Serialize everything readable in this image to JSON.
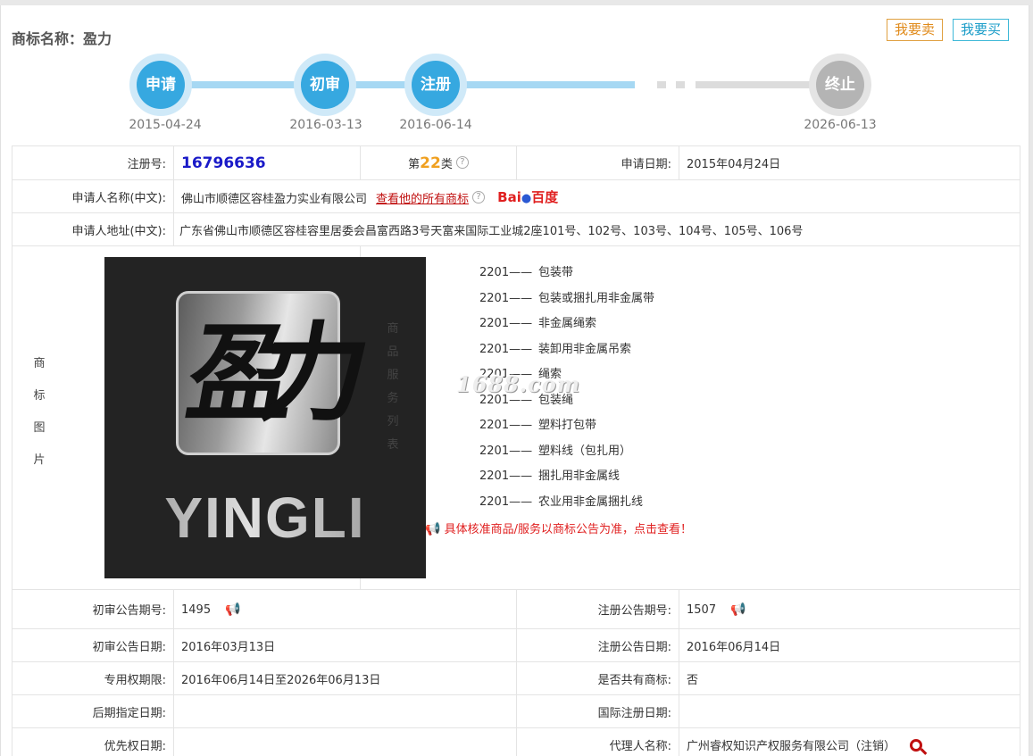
{
  "header": {
    "title": "商标名称：盈力",
    "sell_button": "我要卖",
    "buy_button": "我要买"
  },
  "timeline": {
    "steps": [
      {
        "label": "申请",
        "date": "2015-04-24"
      },
      {
        "label": "初审",
        "date": "2016-03-13"
      },
      {
        "label": "注册",
        "date": "2016-06-14"
      },
      {
        "label": "终止",
        "date": "2026-06-13"
      }
    ],
    "colors": {
      "active": "#36a8e0",
      "track": "#a6d8f3",
      "inactive": "#b4b4b4"
    }
  },
  "info": {
    "reg_no_label": "注册号:",
    "reg_no": "16796636",
    "class_prefix": "第",
    "class_num": "22",
    "class_suffix": "类",
    "apply_date_label": "申请日期:",
    "apply_date": "2015年04月24日",
    "applicant_label": "申请人名称(中文):",
    "applicant": "佛山市顺德区容桂盈力实业有限公司",
    "view_all_link": "查看他的所有商标",
    "baidu_text": "Bai",
    "baidu_text2": "百度",
    "address_label": "申请人地址(中文):",
    "address": "广东省佛山市顺德区容桂容里居委会昌富西路3号天富来国际工业城2座101号、102号、103号、104号、105号、106号",
    "image_label_chars": [
      "商",
      "标",
      "图",
      "片"
    ],
    "goods_label_chars": [
      "商",
      "品",
      "服",
      "务",
      "列",
      "表"
    ],
    "logo_text": "YINGLI",
    "logo_char": "盈力",
    "goods": [
      {
        "code": "2201——",
        "name": "包装带"
      },
      {
        "code": "2201——",
        "name": "包装或捆扎用非金属带"
      },
      {
        "code": "2201——",
        "name": "非金属绳索"
      },
      {
        "code": "2201——",
        "name": "装卸用非金属吊索"
      },
      {
        "code": "2201——",
        "name": "绳索"
      },
      {
        "code": "2201——",
        "name": "包装绳"
      },
      {
        "code": "2201——",
        "name": "塑料打包带"
      },
      {
        "code": "2201——",
        "name": "塑料线（包扎用）"
      },
      {
        "code": "2201——",
        "name": "捆扎用非金属线"
      },
      {
        "code": "2201——",
        "name": "农业用非金属捆扎线"
      }
    ],
    "goods_notice": "具体核准商品/服务以商标公告为准，点击查看！",
    "watermark": "1688.com",
    "prelim_no_label": "初审公告期号:",
    "prelim_no": "1495",
    "reg_notice_no_label": "注册公告期号:",
    "reg_notice_no": "1507",
    "prelim_date_label": "初审公告日期:",
    "prelim_date": "2016年03月13日",
    "reg_notice_date_label": "注册公告日期:",
    "reg_notice_date": "2016年06月14日",
    "exclusive_label": "专用权期限:",
    "exclusive": "2016年06月14日至2026年06月13日",
    "shared_label": "是否共有商标:",
    "shared": "否",
    "later_label": "后期指定日期:",
    "later": "",
    "intl_label": "国际注册日期:",
    "intl": "",
    "priority_label": "优先权日期:",
    "priority": "",
    "agent_label": "代理人名称:",
    "agent": "广州睿权知识产权服务有限公司（注销）"
  }
}
